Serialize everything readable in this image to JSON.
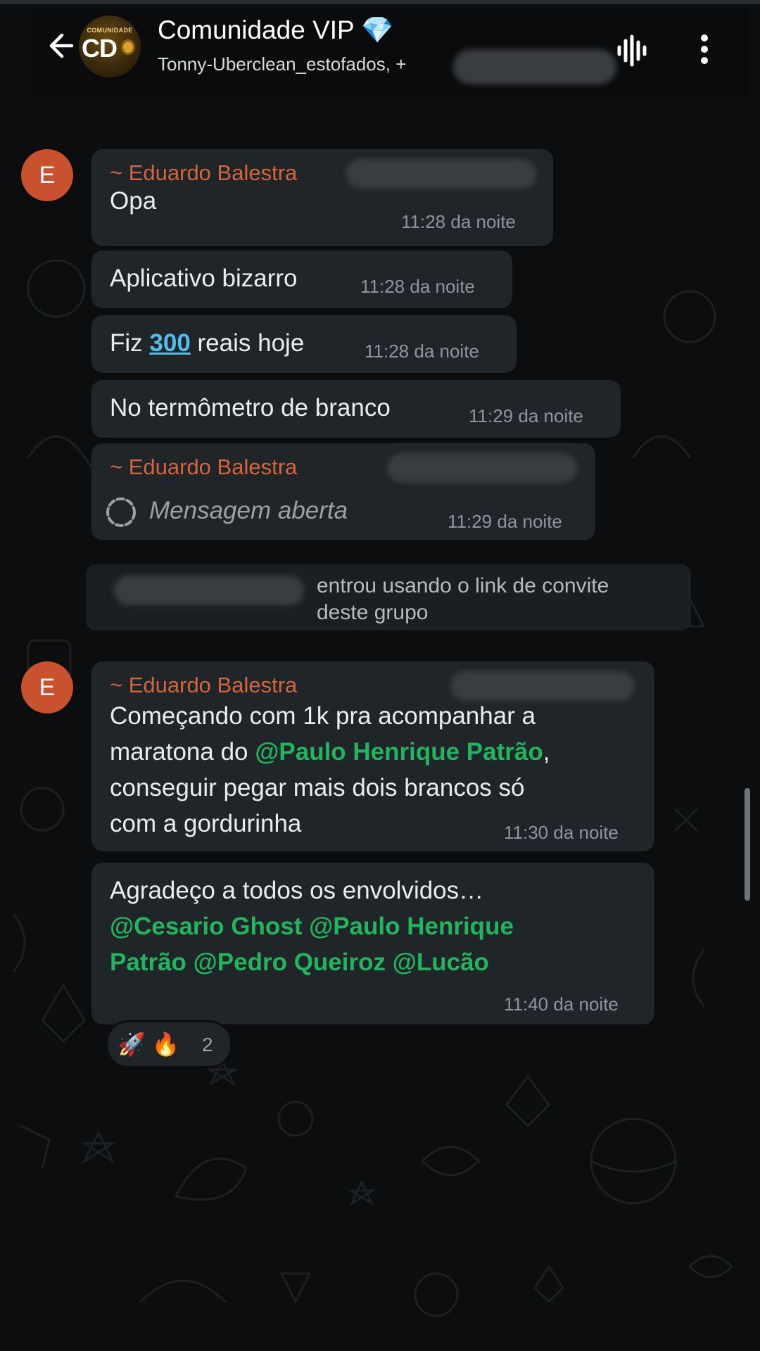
{
  "header": {
    "group_name": "Comunidade VIP 💎",
    "subtitle": "Tonny-Uberclean_estofados, +",
    "avatar_small_text": "COMUNIDADE",
    "avatar_big_text": "CD"
  },
  "messages": [
    {
      "sender": "~ Eduardo Balestra",
      "avatar_letter": "E",
      "text": "Opa",
      "time": "11:28 da noite"
    },
    {
      "text": "Aplicativo bizarro",
      "time": "11:28 da noite"
    },
    {
      "text_before": "Fiz ",
      "link": "300",
      "text_after": " reais hoje",
      "time": "11:28 da noite"
    },
    {
      "text": "No termômetro de branco",
      "time": "11:29 da noite"
    },
    {
      "sender": "~ Eduardo Balestra",
      "text": "Mensagem aberta",
      "time": "11:29 da noite"
    }
  ],
  "system_message": {
    "line1": "entrou usando o link de convite",
    "line2": "deste grupo"
  },
  "messages2": [
    {
      "sender": "~ Eduardo Balestra",
      "avatar_letter": "E",
      "line1": "Começando com 1k pra acompanhar a",
      "line2_before": "maratona do ",
      "line2_mention": "@Paulo Henrique Patrão",
      "line2_after": ",",
      "line3": "conseguir pegar mais dois brancos só",
      "line4": "com a gordurinha",
      "time": "11:30 da noite"
    },
    {
      "line1": "Agradeço a todos os envolvidos…",
      "line2": "@Cesario Ghost @Paulo Henrique",
      "line3": "Patrão @Pedro Queiroz @Lucão",
      "time": "11:40 da noite"
    }
  ],
  "reactions": {
    "emojis": "🚀 🔥",
    "count": "2"
  },
  "colors": {
    "accent_name": "#d4653c",
    "mention": "#23b45e",
    "link": "#53bdeb",
    "bubble": "#1f2528"
  }
}
